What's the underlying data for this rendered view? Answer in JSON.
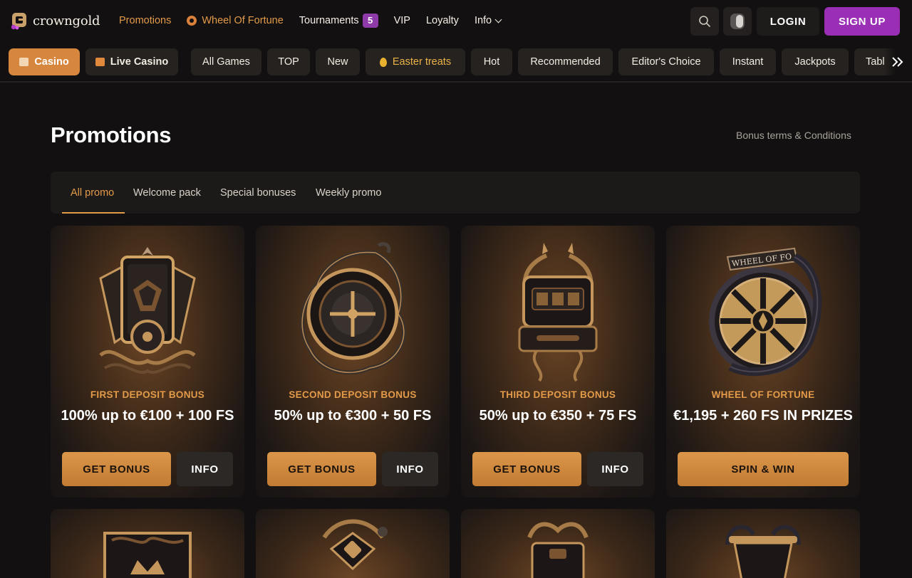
{
  "brand": {
    "name": "crowngold"
  },
  "nav": {
    "items": [
      {
        "label": "Promotions",
        "active": true
      },
      {
        "label": "Wheel Of Fortune",
        "icon": "wheel-icon"
      },
      {
        "label": "Tournaments",
        "badge": "5"
      },
      {
        "label": "VIP"
      },
      {
        "label": "Loyalty"
      },
      {
        "label": "Info",
        "icon": "chevron-down-icon"
      }
    ]
  },
  "header_actions": {
    "search_icon": "search-icon",
    "theme_icon": "theme-toggle-icon",
    "login_label": "LOGIN",
    "signup_label": "SIGN UP"
  },
  "categories": [
    {
      "label": "Casino",
      "icon": "casino-icon",
      "active": true
    },
    {
      "label": "Live Casino",
      "icon": "live-casino-icon"
    },
    {
      "label": "All Games"
    },
    {
      "label": "TOP"
    },
    {
      "label": "New"
    },
    {
      "label": "Easter treats",
      "icon": "egg-icon"
    },
    {
      "label": "Hot"
    },
    {
      "label": "Recommended"
    },
    {
      "label": "Editor's Choice"
    },
    {
      "label": "Instant"
    },
    {
      "label": "Jackpots"
    },
    {
      "label": "Tabl"
    }
  ],
  "page": {
    "title": "Promotions",
    "terms_link": "Bonus terms & Conditions"
  },
  "tabs": [
    {
      "label": "All promo",
      "active": true
    },
    {
      "label": "Welcome pack"
    },
    {
      "label": "Special bonuses"
    },
    {
      "label": "Weekly promo"
    }
  ],
  "promos": [
    {
      "title": "FIRST DEPOSIT BONUS",
      "desc": "100% up to €100 + 100 FS",
      "primary": "GET BONUS",
      "secondary": "INFO"
    },
    {
      "title": "SECOND DEPOSIT BONUS",
      "desc": "50% up to €300 + 50 FS",
      "primary": "GET BONUS",
      "secondary": "INFO"
    },
    {
      "title": "THIRD DEPOSIT BONUS",
      "desc": "50% up to €350 + 75 FS",
      "primary": "GET BONUS",
      "secondary": "INFO"
    },
    {
      "title": "WHEEL OF FORTUNE",
      "desc": "€1,195 + 260 FS IN PRIZES",
      "primary": "SPIN & WIN",
      "art_text": "WHEEL OF FO"
    }
  ],
  "colors": {
    "accent": "#e39a49",
    "signup": "#9a2fb6",
    "badge": "#8e3aa8",
    "background": "#121010",
    "card": "#1c1a19"
  }
}
